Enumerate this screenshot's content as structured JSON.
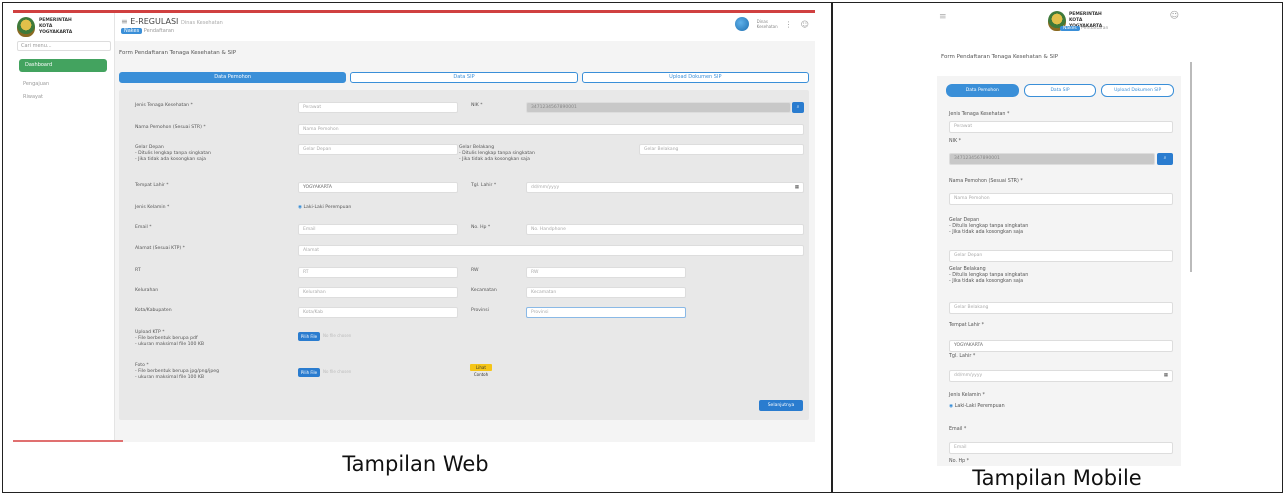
{
  "captions": {
    "web": "Tampilan Web",
    "mobile": "Tampilan Mobile"
  },
  "web": {
    "logo_text": "PEMERINTAH KOTA YOGYAKARTA",
    "search_placeholder": "Cari menu...",
    "sidebar": {
      "active": "Dashboard",
      "items": [
        "Pengajuan",
        "Riwayat"
      ]
    },
    "app_title": "E-REGULASI",
    "app_subtitle": "Dinas Kesehatan",
    "breadcrumb_badge": "Nakes",
    "breadcrumb": "Pendaftaran",
    "header_text": "Dinas Kesehatan",
    "form_title": "Form Pendaftaran Tenaga Kesehatan & SIP",
    "tabs": [
      "Data Pemohon",
      "Data SIP",
      "Upload Dokumen SIP"
    ],
    "fields": {
      "jenis_nakes_label": "Jenis Tenaga Kesehatan *",
      "jenis_nakes_value": "Perawat",
      "nik_label": "NIK *",
      "nik_value": "3471234567890001",
      "nama_label": "Nama Pemohon (Sesuai STR) *",
      "nama_placeholder": "Nama Pemohon",
      "gelar_depan_label": "Gelar Depan",
      "gelar_depan_hint1": "- Ditulis lengkap tanpa singkatan",
      "gelar_depan_hint2": "- Jika tidak ada kosongkan saja",
      "gelar_depan_placeholder": "Gelar Depan",
      "gelar_belakang_label": "Gelar Belakang",
      "gelar_belakang_hint1": "- Ditulis lengkap tanpa singkatan",
      "gelar_belakang_hint2": "- Jika tidak ada kosongkan saja",
      "gelar_belakang_placeholder": "Gelar Belakang",
      "tempat_lahir_label": "Tempat Lahir *",
      "tempat_lahir_value": "YOGYAKARTA",
      "tgl_lahir_label": "Tgl. Lahir *",
      "tgl_lahir_value": "dd/mm/yyyy",
      "jk_label": "Jenis Kelamin *",
      "jk_options": "Laki-Laki   Perempuan",
      "email_label": "Email *",
      "email_placeholder": "Email",
      "hp_label": "No. Hp *",
      "hp_placeholder": "No. Handphone",
      "alamat_label": "Alamat (Sesuai KTP) *",
      "alamat_placeholder": "Alamat",
      "rt_label": "RT",
      "rt_placeholder": "RT",
      "rw_label": "RW",
      "rw_placeholder": "RW",
      "kelurahan_label": "Kelurahan",
      "kelurahan_placeholder": "Kelurahan",
      "kecamatan_label": "Kecamatan",
      "kecamatan_placeholder": "Kecamatan",
      "kota_label": "Kota/Kabupaten",
      "kota_placeholder": "Kota/Kab",
      "provinsi_label": "Provinsi",
      "provinsi_placeholder": "Provinsi",
      "upload_ktp_label": "Upload KTP *",
      "upload_ktp_hint1": "- File berbentuk berupa pdf",
      "upload_ktp_hint2": "- ukuran maksimal file 100 KB",
      "pilih_file": "Pilih File",
      "no_file": "No file chosen",
      "foto_label": "Foto *",
      "foto_hint1": "- File berbentuk berupa jpg/png/jpeg",
      "foto_hint2": "- ukuran maksimal file 100 KB",
      "contoh": "Lihat Contoh",
      "simpan": "Selanjutnya"
    }
  },
  "mobile": {
    "logo_text": "PEMERINTAH KOTA YOGYAKARTA",
    "breadcrumb_badge": "Nakes",
    "breadcrumb": "Pendaftaran",
    "form_title": "Form Pendaftaran Tenaga Kesehatan & SIP",
    "tabs": [
      "Data Pemohon",
      "Data SIP",
      "Upload Dokumen SIP"
    ],
    "jenis_label": "Jenis Tenaga Kesehatan *",
    "jenis_value": "Perawat",
    "nik_label": "NIK *",
    "nik_value": "3471234567890001",
    "nama_label": "Nama Pemohon (Sesuai STR) *",
    "nama_placeholder": "Nama Pemohon",
    "gelar_depan_label": "Gelar Depan",
    "gelar_depan_hint1": "- Ditulis lengkap tanpa singkatan",
    "gelar_depan_hint2": "- Jika tidak ada kosongkan saja",
    "gelar_depan_placeholder": "Gelar Depan",
    "gelar_belakang_label": "Gelar Belakang",
    "gelar_belakang_hint1": "- Ditulis lengkap tanpa singkatan",
    "gelar_belakang_hint2": "- Jika tidak ada kosongkan saja",
    "gelar_belakang_placeholder": "Gelar Belakang",
    "tempat_label": "Tempat Lahir *",
    "tempat_value": "YOGYAKARTA",
    "tgl_label": "Tgl. Lahir *",
    "tgl_value": "dd/mm/yyyy",
    "jk_label": "Jenis Kelamin *",
    "jk_options": "Laki-Laki   Perempuan",
    "email_label": "Email *",
    "email_placeholder": "Email",
    "hp_label": "No. Hp *"
  }
}
